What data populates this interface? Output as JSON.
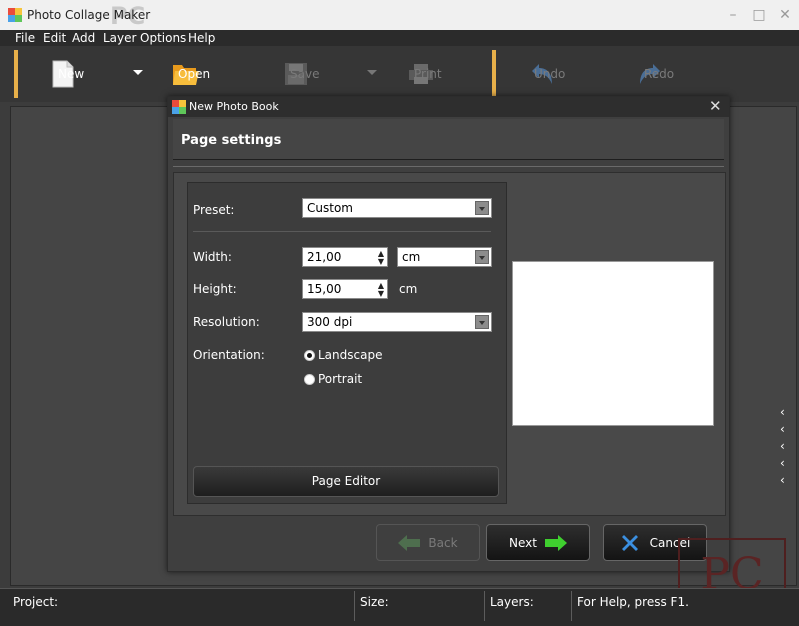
{
  "window": {
    "title": "Photo Collage Maker",
    "watermark": "PC"
  },
  "menu": [
    "File",
    "Edit",
    "Add",
    "Layer",
    "Options",
    "Help"
  ],
  "toolbar": {
    "new": "New",
    "open": "Open",
    "save": "Save",
    "print": "Print",
    "undo": "Undo",
    "redo": "Redo"
  },
  "dialog": {
    "title": "New Photo Book",
    "heading": "Page settings",
    "preset_label": "Preset:",
    "preset_value": "Custom",
    "width_label": "Width:",
    "width_value": "21,00",
    "unit_value": "cm",
    "height_label": "Height:",
    "height_value": "15,00",
    "height_unit": "cm",
    "resolution_label": "Resolution:",
    "resolution_value": "300 dpi",
    "orientation_label": "Orientation:",
    "orientation_options": [
      "Landscape",
      "Portrait"
    ],
    "orientation_selected": "Landscape",
    "page_editor": "Page Editor",
    "back": "Back",
    "next": "Next",
    "cancel": "Cancel"
  },
  "statusbar": {
    "project": "Project:",
    "size": "Size:",
    "layers": "Layers:",
    "help": "For Help, press F1."
  },
  "colors": {
    "accent": "#e8b04a",
    "next_arrow": "#3fcf2f",
    "cancel_x": "#3b8fe0"
  },
  "corner_watermark": "PC"
}
